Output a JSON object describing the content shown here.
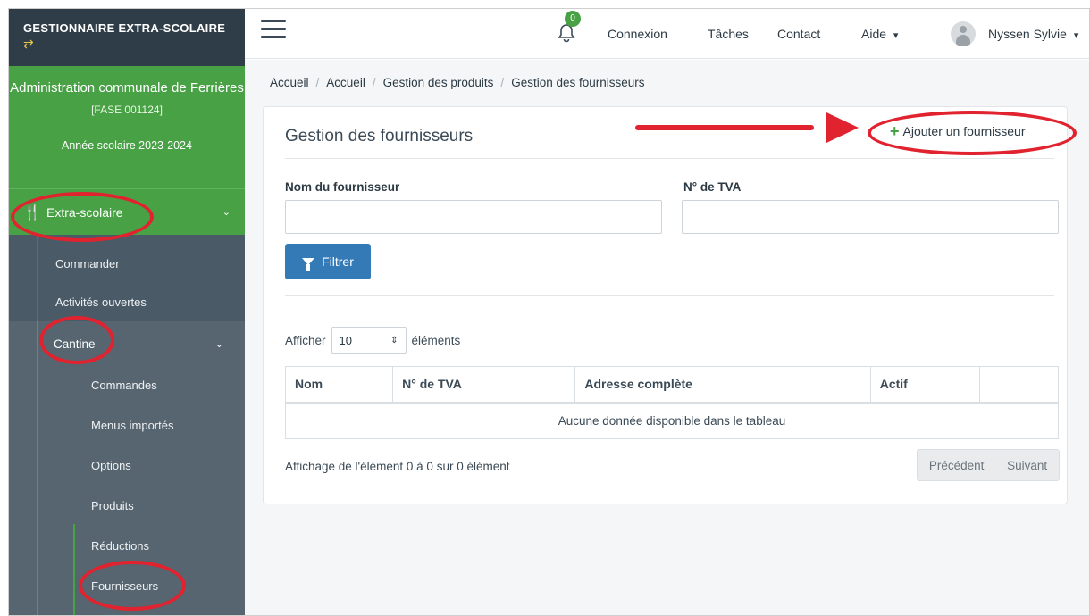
{
  "sidebar": {
    "brand": "GESTIONNAIRE EXTRA-SCOLAIRE",
    "org_name": "Administration communale de Ferrières",
    "org_code": "[FASE 001124]",
    "school_year": "Année scolaire 2023-2024",
    "section": "Extra-scolaire",
    "items": [
      {
        "label": "Commander"
      },
      {
        "label": "Activités ouvertes"
      }
    ],
    "cantine": "Cantine",
    "cantine_items": [
      {
        "label": "Commandes"
      },
      {
        "label": "Menus importés"
      },
      {
        "label": "Options"
      },
      {
        "label": "Produits"
      },
      {
        "label": "Réductions"
      },
      {
        "label": "Fournisseurs"
      }
    ]
  },
  "topbar": {
    "notification_count": "0",
    "nav": [
      "Connexion",
      "Tâches",
      "Contact",
      "Aide"
    ],
    "user": "Nyssen Sylvie"
  },
  "breadcrumb": [
    "Accueil",
    "Accueil",
    "Gestion des produits",
    "Gestion des fournisseurs"
  ],
  "card": {
    "title": "Gestion des fournisseurs",
    "add_label": "Ajouter un fournisseur",
    "field_name_label": "Nom du fournisseur",
    "field_vat_label": "N° de TVA",
    "field_name_value": "",
    "field_vat_value": "",
    "filter_label": "Filtrer",
    "show_prefix": "Afficher",
    "show_value": "10",
    "show_suffix": "éléments",
    "columns": [
      "Nom",
      "N° de TVA",
      "Adresse complète",
      "Actif",
      "",
      ""
    ],
    "empty_message": "Aucune donnée disponible dans le tableau",
    "info": "Affichage de l'élément 0 à 0 sur 0 élément",
    "prev": "Précédent",
    "next": "Suivant"
  },
  "colors": {
    "green": "#48a145",
    "sidebar": "#3f4f5c",
    "primary": "#337ab7",
    "annotation": "#e0232f"
  }
}
